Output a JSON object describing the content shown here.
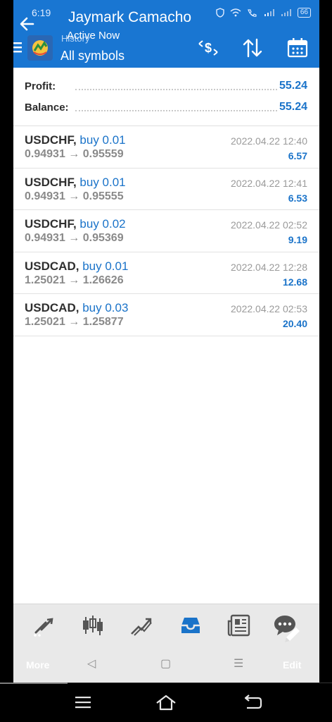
{
  "status_bar": {
    "time": "6:19",
    "battery": "66"
  },
  "chat_overlay": {
    "name": "Jaymark Camacho",
    "status": "Active Now"
  },
  "header": {
    "section": "History",
    "title": "All symbols"
  },
  "summary": {
    "profit_label": "Profit:",
    "profit_value": "55.24",
    "balance_label": "Balance:",
    "balance_value": "55.24"
  },
  "deals": [
    {
      "symbol": "USDCHF,",
      "type": "buy 0.01",
      "open": "0.94931",
      "arrow": "→",
      "close": "0.95559",
      "time": "2022.04.22 12:40",
      "profit": "6.57"
    },
    {
      "symbol": "USDCHF,",
      "type": "buy 0.01",
      "open": "0.94931",
      "arrow": "→",
      "close": "0.95555",
      "time": "2022.04.22 12:41",
      "profit": "6.53"
    },
    {
      "symbol": "USDCHF,",
      "type": "buy 0.02",
      "open": "0.94931",
      "arrow": "→",
      "close": "0.95369",
      "time": "2022.04.22 02:52",
      "profit": "9.19"
    },
    {
      "symbol": "USDCAD,",
      "type": "buy 0.01",
      "open": "1.25021",
      "arrow": "→",
      "close": "1.26626",
      "time": "2022.04.22 12:28",
      "profit": "12.68"
    },
    {
      "symbol": "USDCAD,",
      "type": "buy 0.03",
      "open": "1.25021",
      "arrow": "→",
      "close": "1.25877",
      "time": "2022.04.22 02:53",
      "profit": "20.40"
    }
  ],
  "toolbar": {
    "more_label": "More",
    "edit_label": "Edit",
    "active_color": "#1a73c9",
    "icons": [
      "quotes-icon",
      "chart-icon",
      "trade-icon",
      "history-icon",
      "news-icon",
      "chat-icon"
    ]
  },
  "colors": {
    "header_bg": "#1976d2",
    "accent": "#1a73c9"
  }
}
